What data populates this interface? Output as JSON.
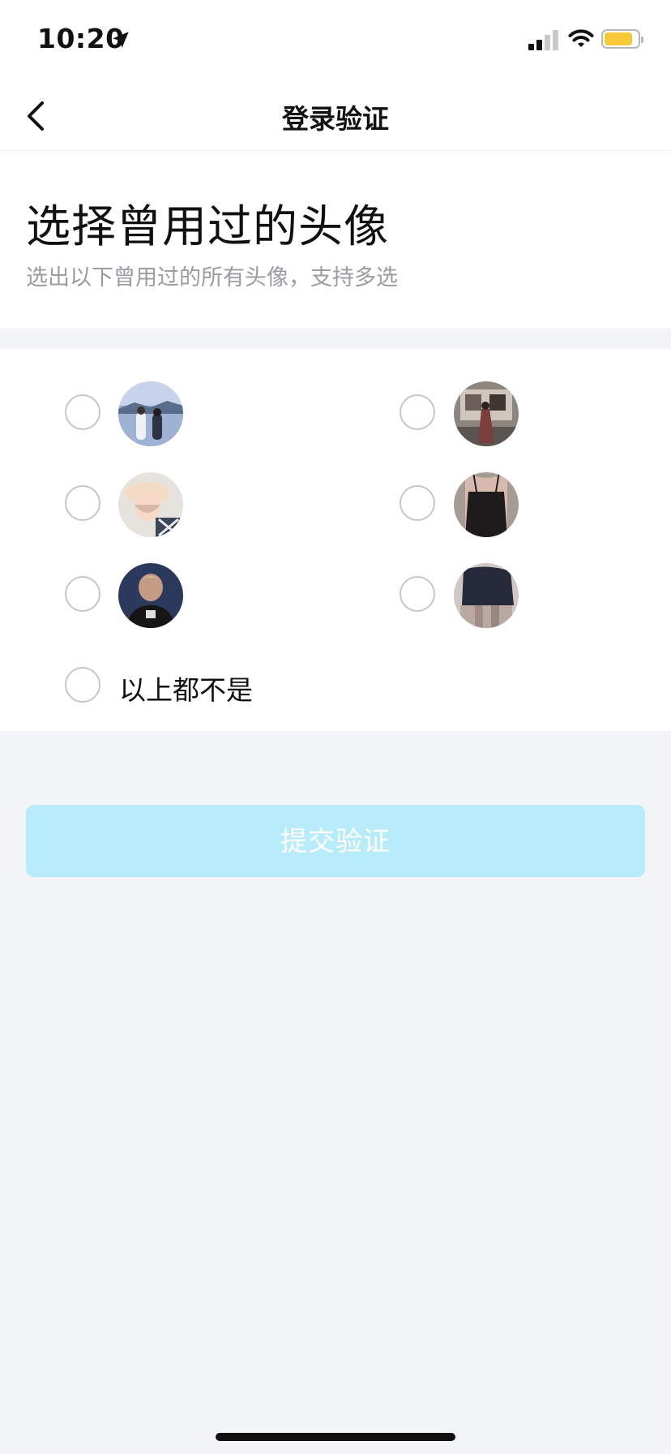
{
  "status_bar": {
    "time": "10:20"
  },
  "nav": {
    "title": "登录验证"
  },
  "header": {
    "title": "选择曾用过的头像",
    "subtitle": "选出以下曾用过的所有头像，支持多选"
  },
  "options": {
    "none_label": "以上都不是"
  },
  "submit": {
    "label": "提交验证"
  },
  "colors": {
    "submit_disabled": "#b8ecfb",
    "battery": "#f6c938",
    "background": "#f3f4f7"
  },
  "icons": [
    "location-arrow-icon",
    "signal-icon",
    "wifi-icon",
    "battery-icon",
    "back-chevron-icon"
  ]
}
